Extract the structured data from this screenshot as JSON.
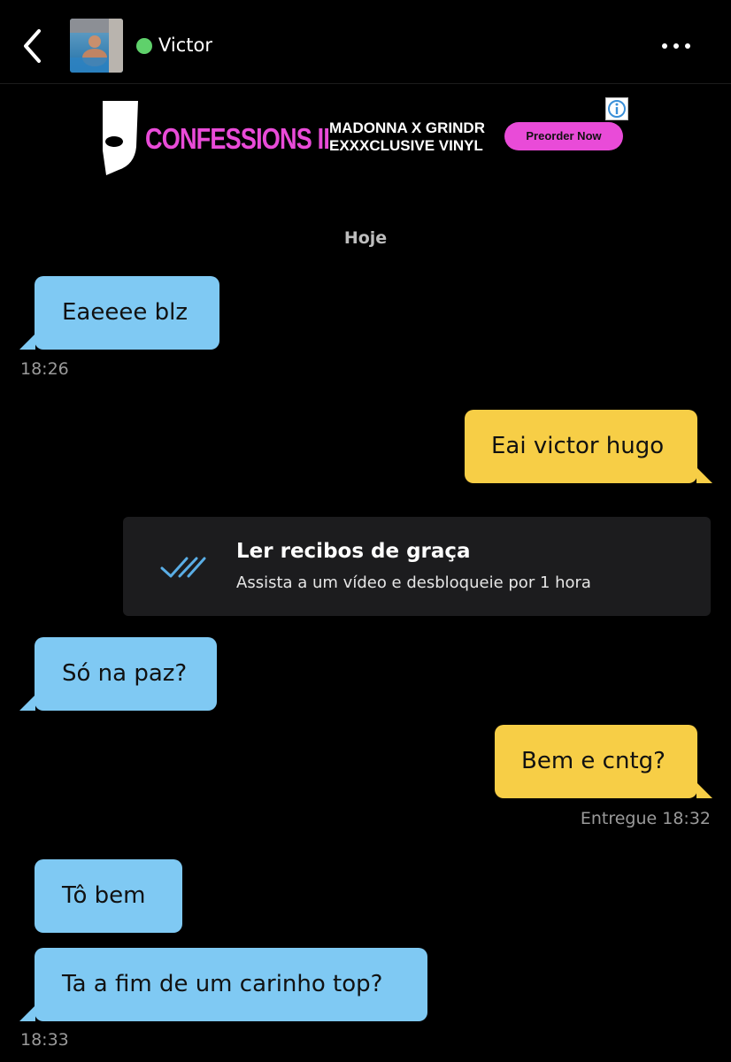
{
  "header": {
    "contact_name": "Victor",
    "online": true
  },
  "ad": {
    "title": "CONFESSIONS II",
    "subtitle_line1": "MADONNA X GRINDR",
    "subtitle_line2": "EXXXCLUSIVE VINYL",
    "cta": "Preorder Now",
    "accent_color": "#e94bd8"
  },
  "chat": {
    "date_separator": "Hoje",
    "messages": [
      {
        "side": "in",
        "text": "Eaeeee blz"
      },
      {
        "side": "out",
        "text": "Eai victor hugo"
      },
      {
        "side": "in",
        "text": "Só na paz?"
      },
      {
        "side": "out",
        "text": "Bem e cntg?"
      },
      {
        "side": "in",
        "text": "Tô bem"
      },
      {
        "side": "in",
        "text": "Ta a fim de um carinho top?"
      }
    ],
    "timestamps": {
      "first": "18:26",
      "delivered": "Entregue 18:32",
      "last": "18:33"
    }
  },
  "read_receipts_promo": {
    "title": "Ler recibos de graça",
    "subtitle": "Assista a um vídeo e desbloqueie por 1 hora",
    "icon": "double-check-icon"
  },
  "colors": {
    "incoming_bubble": "#7fc9f3",
    "outgoing_bubble": "#f7ce46",
    "online_indicator": "#5fd16b"
  }
}
